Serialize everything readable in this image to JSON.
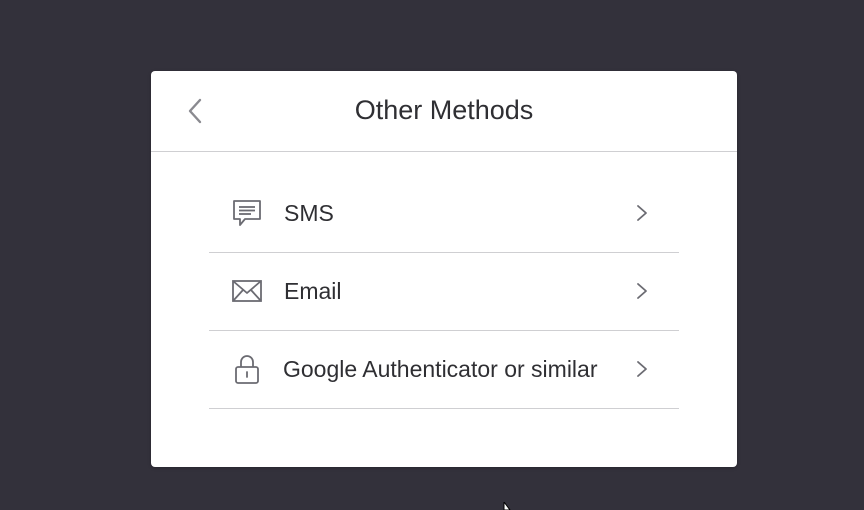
{
  "dialog": {
    "title": "Other Methods",
    "back_icon": "chevron-left-icon"
  },
  "methods": [
    {
      "label": "SMS",
      "icon": "message-icon",
      "chevron": "chevron-right-icon"
    },
    {
      "label": "Email",
      "icon": "envelope-icon",
      "chevron": "chevron-right-icon"
    },
    {
      "label": "Google Authenticator or similar",
      "icon": "lock-icon",
      "chevron": "chevron-right-icon"
    }
  ],
  "colors": {
    "backdrop": "#33313b",
    "dialog_bg": "#ffffff",
    "text": "#2f2f33",
    "icon": "#6b6b72",
    "divider": "#cfcfd2"
  }
}
